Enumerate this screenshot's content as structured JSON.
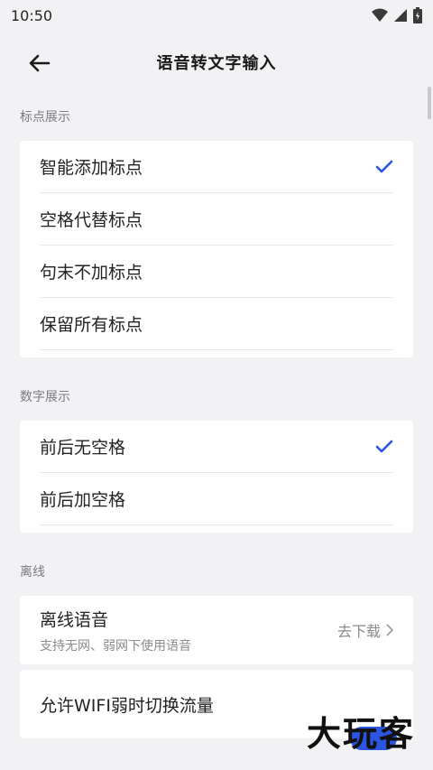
{
  "status": {
    "time": "10:50"
  },
  "header": {
    "title": "语音转文字输入"
  },
  "sections": [
    {
      "title": "标点展示",
      "items": [
        {
          "label": "智能添加标点",
          "checked": true
        },
        {
          "label": "空格代替标点",
          "checked": false
        },
        {
          "label": "句末不加标点",
          "checked": false
        },
        {
          "label": "保留所有标点",
          "checked": false
        }
      ]
    },
    {
      "title": "数字展示",
      "items": [
        {
          "label": "前后无空格",
          "checked": true
        },
        {
          "label": "前后加空格",
          "checked": false
        }
      ]
    },
    {
      "title": "离线",
      "offline_voice": {
        "label": "离线语音",
        "sub": "支持无网、弱网下使用语音",
        "action": "去下载"
      },
      "wifi_switch": {
        "label": "允许WIFI弱时切换流量"
      }
    }
  ],
  "watermark": "大玩客",
  "colors": {
    "accent": "#2b54e0",
    "background": "#f2f2f4"
  }
}
